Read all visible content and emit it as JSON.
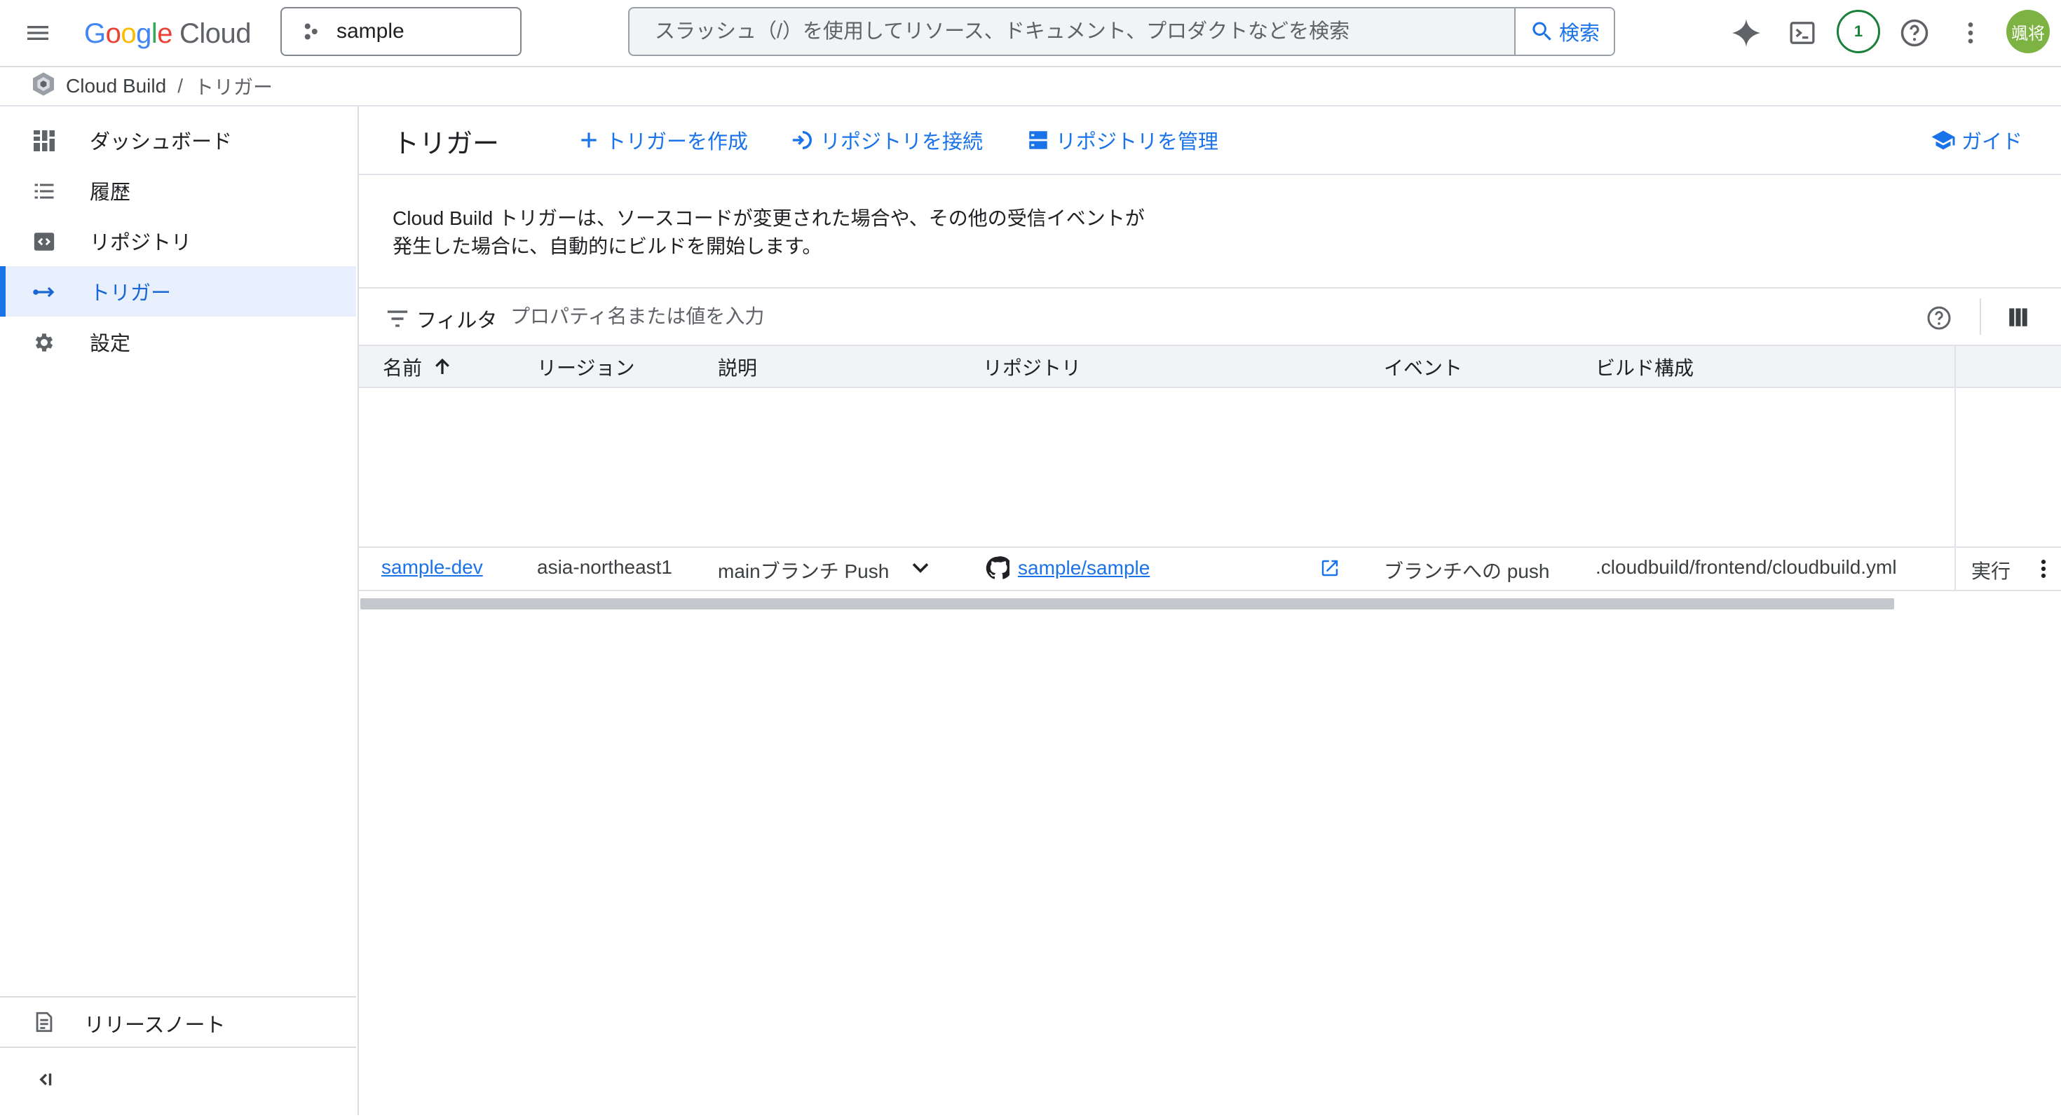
{
  "topbar": {
    "logo_google": [
      "G",
      "o",
      "o",
      "g",
      "l",
      "e"
    ],
    "logo_cloud": "Cloud",
    "project_name": "sample",
    "search_placeholder": "スラッシュ（/）を使用してリソース、ドキュメント、プロダクトなどを検索",
    "search_button": "検索",
    "notification_count": "1",
    "avatar_text": "颯将"
  },
  "breadcrumb": {
    "product": "Cloud Build",
    "separator": "/",
    "current": "トリガー"
  },
  "sidebar": {
    "items": [
      {
        "label": "ダッシュボード",
        "icon": "dashboard-icon"
      },
      {
        "label": "履歴",
        "icon": "list-icon"
      },
      {
        "label": "リポジトリ",
        "icon": "code-icon"
      },
      {
        "label": "トリガー",
        "icon": "trigger-arrow-icon",
        "active": true
      },
      {
        "label": "設定",
        "icon": "gear-icon"
      }
    ],
    "release_notes": "リリースノート",
    "collapse_icon": "collapse-icon"
  },
  "main": {
    "title": "トリガー",
    "actions": {
      "create": "トリガーを作成",
      "connect": "リポジトリを接続",
      "manage": "リポジトリを管理",
      "guide": "ガイド"
    },
    "description": "Cloud Build トリガーは、ソースコードが変更された場合や、その他の受信イベントが発生した場合に、自動的にビルドを開始します。",
    "filter": {
      "label": "フィルタ",
      "placeholder": "プロパティ名または値を入力"
    },
    "table": {
      "columns": [
        "名前",
        "リージョン",
        "説明",
        "リポジトリ",
        "イベント",
        "ビルド構成"
      ],
      "rows": [
        {
          "name": "sample-dev",
          "region": "asia-northeast1",
          "description": "mainブランチ Push",
          "repository": "sample/sample",
          "event": "ブランチへの push",
          "build_config": ".cloudbuild/frontend/cloudbuild.yml",
          "run": "実行"
        }
      ]
    }
  },
  "colors": {
    "accent": "#1a73e8",
    "active_bg": "#e8f0fe",
    "badge_green": "#188038",
    "avatar_bg": "#7cb342"
  }
}
